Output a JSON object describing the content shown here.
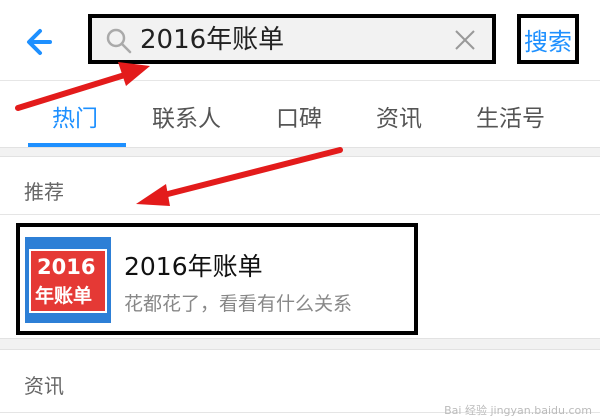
{
  "header": {
    "search_value": "2016年账单",
    "search_button_label": "搜索"
  },
  "tabs": [
    {
      "label": "热门"
    },
    {
      "label": "联系人"
    },
    {
      "label": "口碑"
    },
    {
      "label": "资讯"
    },
    {
      "label": "生活号"
    }
  ],
  "recommend": {
    "section_label": "推荐",
    "item": {
      "thumb_line1": "2016",
      "thumb_line2": "年账单",
      "title": "2016年账单",
      "subtitle": "花都花了，看看有什么关系"
    }
  },
  "news": {
    "section_label": "资讯"
  },
  "watermark": "Bai 经验 jingyan.baidu.com",
  "colors": {
    "accent": "#1e90ff",
    "annotation_arrow": "#e31b1b",
    "highlight_box": "#000000"
  },
  "icons": [
    "back-arrow-icon",
    "search-icon",
    "clear-icon"
  ]
}
